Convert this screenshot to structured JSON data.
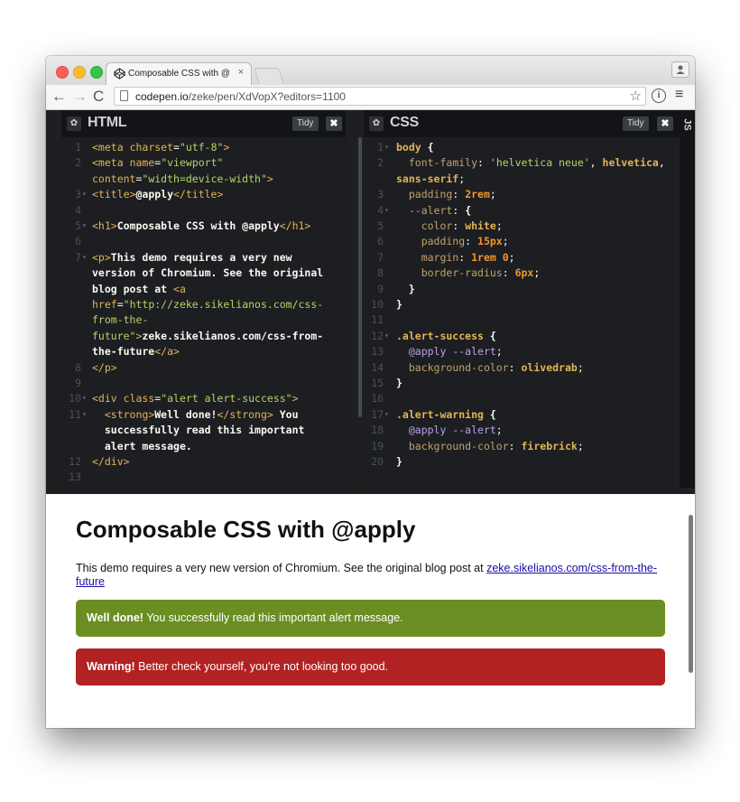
{
  "browser": {
    "tab_title": "Composable CSS with @ap",
    "tab_close": "×",
    "url_host": "codepen.io",
    "url_path": "/zeke/pen/XdVopX?editors=1100",
    "back_label": "←",
    "forward_label": "→",
    "reload_label": "C",
    "star_label": "☆",
    "info_label": "i",
    "menu_label": "≡"
  },
  "editor": {
    "html_title": "HTML",
    "css_title": "CSS",
    "js_label": "JS",
    "tidy_label": "Tidy",
    "close_label": "✖",
    "gear_label": "✿"
  },
  "html_code": [
    {
      "n": "1",
      "html": "<span class=\"tag\">&lt;meta</span> <span class=\"attr\">charset</span>=<span class=\"str\">\"utf-8\"</span><span class=\"tag\">&gt;</span>"
    },
    {
      "n": "2",
      "html": "<span class=\"tag\">&lt;meta</span> <span class=\"attr\">name</span>=<span class=\"str\">\"viewport\"</span>"
    },
    {
      "n": "",
      "html": "<span class=\"attr\">content</span>=<span class=\"str\">\"width=device-width\"</span><span class=\"tag\">&gt;</span>"
    },
    {
      "n": "3",
      "fold": true,
      "html": "<span class=\"tag\">&lt;title&gt;</span><span class=\"txt\">@apply</span><span class=\"tag\">&lt;/title&gt;</span>"
    },
    {
      "n": "4",
      "html": ""
    },
    {
      "n": "5",
      "fold": true,
      "html": "<span class=\"tag\">&lt;h1&gt;</span><span class=\"txt\">Composable CSS with @apply</span><span class=\"tag\">&lt;/h1&gt;</span>"
    },
    {
      "n": "6",
      "html": ""
    },
    {
      "n": "7",
      "fold": true,
      "html": "<span class=\"tag\">&lt;p&gt;</span><span class=\"txt\">This demo requires a very new</span>"
    },
    {
      "n": "",
      "html": "<span class=\"txt\">version of Chromium. See the original</span>"
    },
    {
      "n": "",
      "html": "<span class=\"txt\">blog post at </span><span class=\"tag\">&lt;a</span>"
    },
    {
      "n": "",
      "html": "<span class=\"attr\">href</span>=<span class=\"str\">\"http://zeke.sikelianos.com/css-</span>"
    },
    {
      "n": "",
      "html": "<span class=\"str\">from-the-</span>"
    },
    {
      "n": "",
      "html": "<span class=\"str\">future\"</span><span class=\"tag\">&gt;</span><span class=\"txt\">zeke.sikelianos.com/css-from-</span>"
    },
    {
      "n": "",
      "html": "<span class=\"txt\">the-future</span><span class=\"tag\">&lt;/a&gt;</span>"
    },
    {
      "n": "8",
      "html": "<span class=\"tag\">&lt;/p&gt;</span>"
    },
    {
      "n": "9",
      "html": ""
    },
    {
      "n": "10",
      "fold": true,
      "html": "<span class=\"tag\">&lt;div</span> <span class=\"attr\">class</span>=<span class=\"str\">\"alert alert-success\"</span><span class=\"tag\">&gt;</span>"
    },
    {
      "n": "11",
      "fold": true,
      "html": "  <span class=\"tag\">&lt;strong&gt;</span><span class=\"txt\">Well done!</span><span class=\"tag\">&lt;/strong&gt;</span><span class=\"txt\"> You</span>"
    },
    {
      "n": "",
      "html": "  <span class=\"txt\">successfully read this important</span>"
    },
    {
      "n": "",
      "html": "  <span class=\"txt\">alert message.</span>"
    },
    {
      "n": "12",
      "html": "<span class=\"tag\">&lt;/div&gt;</span>"
    },
    {
      "n": "13",
      "html": ""
    }
  ],
  "css_code": [
    {
      "n": "1",
      "fold": true,
      "html": "<span class=\"sel\">body</span> <span class=\"punc\">{</span>"
    },
    {
      "n": "2",
      "html": "  <span class=\"prop\">font-family</span>: <span class=\"str\">'helvetica neue'</span>, <span class=\"val\">helvetica</span>,"
    },
    {
      "n": "",
      "html": "<span class=\"val\">sans-serif</span>;"
    },
    {
      "n": "3",
      "html": "  <span class=\"prop\">padding</span>: <span class=\"num\">2rem</span>;"
    },
    {
      "n": "4",
      "fold": true,
      "html": "  <span class=\"prop\">--alert</span>: <span class=\"punc\">{</span>"
    },
    {
      "n": "5",
      "html": "    <span class=\"prop\">color</span>: <span class=\"val\">white</span>;"
    },
    {
      "n": "6",
      "html": "    <span class=\"prop\">padding</span>: <span class=\"num\">15px</span>;"
    },
    {
      "n": "7",
      "html": "    <span class=\"prop\">margin</span>: <span class=\"num\">1rem 0</span>;"
    },
    {
      "n": "8",
      "html": "    <span class=\"prop\">border-radius</span>: <span class=\"num\">6px</span>;"
    },
    {
      "n": "9",
      "html": "  <span class=\"punc\">}</span>"
    },
    {
      "n": "10",
      "html": "<span class=\"punc\">}</span>"
    },
    {
      "n": "11",
      "html": ""
    },
    {
      "n": "12",
      "fold": true,
      "html": "<span class=\"sel\">.alert-success</span> <span class=\"punc\">{</span>"
    },
    {
      "n": "13",
      "html": "  <span class=\"at\">@apply --alert</span>;"
    },
    {
      "n": "14",
      "html": "  <span class=\"prop\">background-color</span>: <span class=\"val\">olivedrab</span>;"
    },
    {
      "n": "15",
      "html": "<span class=\"punc\">}</span>"
    },
    {
      "n": "16",
      "html": ""
    },
    {
      "n": "17",
      "fold": true,
      "html": "<span class=\"sel\">.alert-warning</span> <span class=\"punc\">{</span>"
    },
    {
      "n": "18",
      "html": "  <span class=\"at\">@apply --alert</span>;"
    },
    {
      "n": "19",
      "html": "  <span class=\"prop\">background-color</span>: <span class=\"val\">firebrick</span>;"
    },
    {
      "n": "20",
      "html": "<span class=\"punc\">}</span>"
    }
  ],
  "preview": {
    "heading": "Composable CSS with @apply",
    "paragraph_text": "This demo requires a very new version of Chromium. See the original blog post at ",
    "link_text": "zeke.sikelianos.com/css-from-the-future",
    "success_strong": "Well done!",
    "success_text": " You successfully read this important alert message.",
    "warning_strong": "Warning!",
    "warning_text": " Better check yourself, you're not looking too good."
  },
  "colors": {
    "success": "#6b8e23",
    "warning": "#b22222",
    "editor_bg": "#1d1e22"
  }
}
